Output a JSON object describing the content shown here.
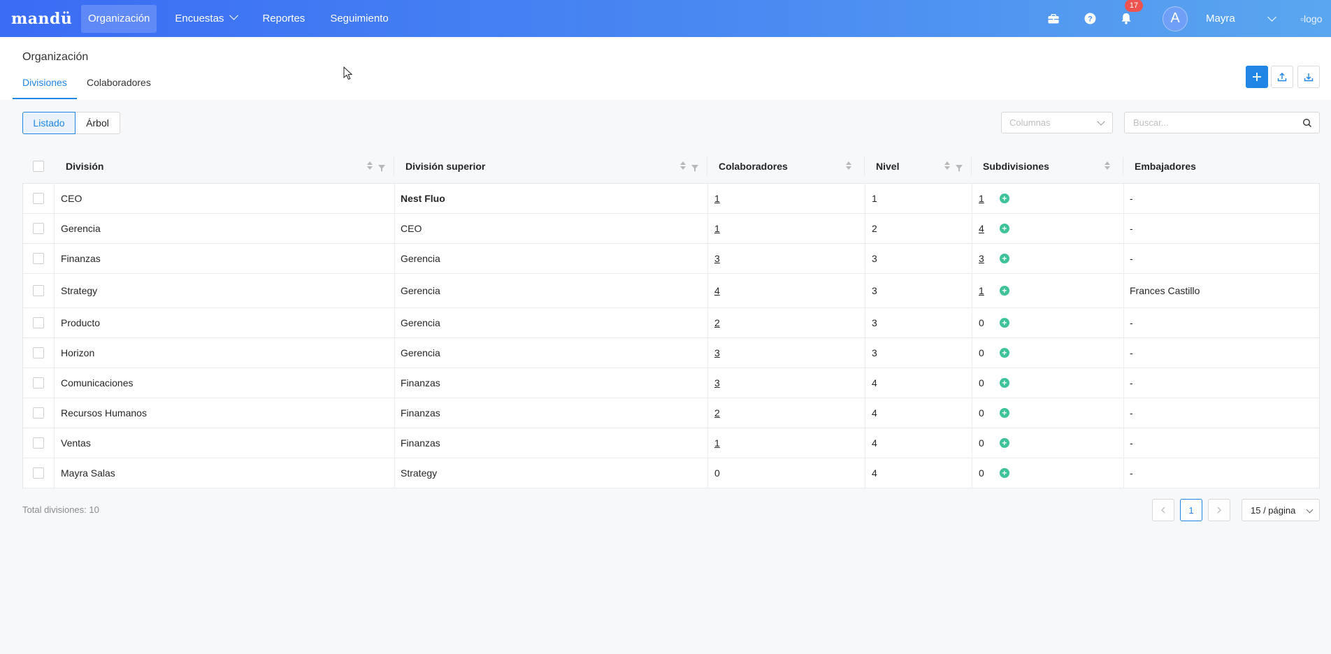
{
  "app": {
    "brand": "mandü",
    "nav": [
      {
        "label": "Organización",
        "active": true
      },
      {
        "label": "Encuestas",
        "dropdown": true
      },
      {
        "label": "Reportes"
      },
      {
        "label": "Seguimiento"
      }
    ],
    "notifications_count": "17",
    "avatar_letter": "A",
    "user_name": "Mayra",
    "logo_alt": "logo"
  },
  "page": {
    "title": "Organización",
    "tabs": [
      {
        "label": "Divisiones",
        "active": true
      },
      {
        "label": "Colaboradores"
      }
    ],
    "actions": [
      "plus-icon",
      "upload-icon",
      "download-icon"
    ]
  },
  "toolbar": {
    "view_list": "Listado",
    "view_tree": "Árbol",
    "columns_placeholder": "Columnas",
    "search_placeholder": "Buscar..."
  },
  "table": {
    "headers": {
      "division": "División",
      "superior": "División superior",
      "colaboradores": "Colaboradores",
      "nivel": "Nivel",
      "subdivisiones": "Subdivisiones",
      "embajadores": "Embajadores"
    },
    "rows": [
      {
        "division": "CEO",
        "superior": "Nest Fluo",
        "colaboradores": "1",
        "nivel": "1",
        "subdivisiones": "1",
        "embajadores": "-"
      },
      {
        "division": "Gerencia",
        "superior": "CEO",
        "colaboradores": "1",
        "nivel": "2",
        "subdivisiones": "4",
        "embajadores": "-"
      },
      {
        "division": "Finanzas",
        "superior": "Gerencia",
        "colaboradores": "3",
        "nivel": "3",
        "subdivisiones": "3",
        "embajadores": "-"
      },
      {
        "division": "Strategy",
        "superior": "Gerencia",
        "colaboradores": "4",
        "nivel": "3",
        "subdivisiones": "1",
        "embajadores": "Frances Castillo"
      },
      {
        "division": "Producto",
        "superior": "Gerencia",
        "colaboradores": "2",
        "nivel": "3",
        "subdivisiones": "0",
        "embajadores": "-"
      },
      {
        "division": "Horizon",
        "superior": "Gerencia",
        "colaboradores": "3",
        "nivel": "3",
        "subdivisiones": "0",
        "embajadores": "-"
      },
      {
        "division": "Comunicaciones",
        "superior": "Finanzas",
        "colaboradores": "3",
        "nivel": "4",
        "subdivisiones": "0",
        "embajadores": "-"
      },
      {
        "division": "Recursos Humanos",
        "superior": "Finanzas",
        "colaboradores": "2",
        "nivel": "4",
        "subdivisiones": "0",
        "embajadores": "-"
      },
      {
        "division": "Ventas",
        "superior": "Finanzas",
        "colaboradores": "1",
        "nivel": "4",
        "subdivisiones": "0",
        "embajadores": "-"
      },
      {
        "division": "Mayra Salas",
        "superior": "Strategy",
        "colaboradores": "0",
        "nivel": "4",
        "subdivisiones": "0",
        "embajadores": "-"
      }
    ]
  },
  "footer": {
    "total": "Total divisiones: 10",
    "current_page": "1",
    "page_size": "15 / página"
  },
  "colors": {
    "primary": "#1f86e6",
    "nav_gradient_start": "#3a6cf4",
    "nav_gradient_end": "#5aa6ef",
    "add_subdivision": "#3ec29a",
    "badge": "#ef5350"
  }
}
